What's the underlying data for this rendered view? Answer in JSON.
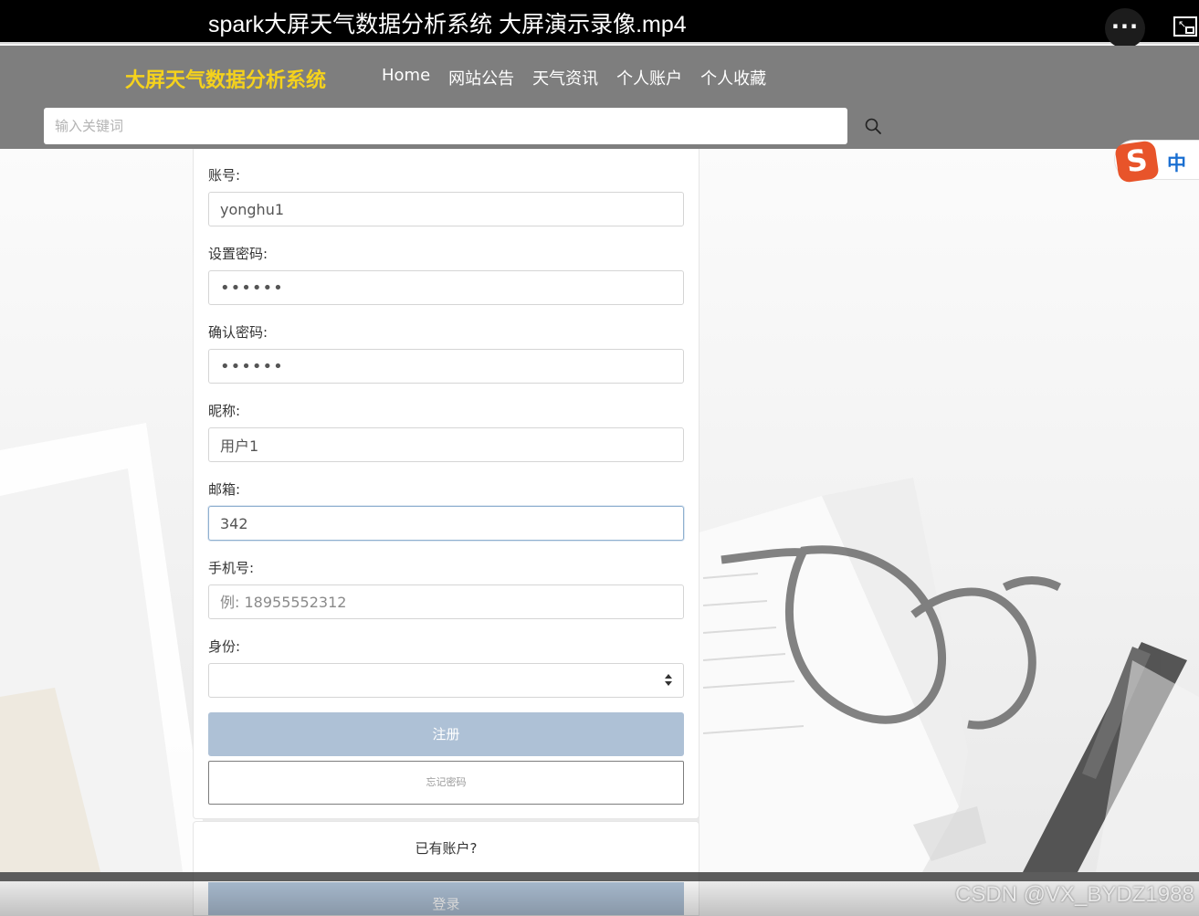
{
  "player": {
    "title": "spark大屏天气数据分析系统 大屏演示录像.mp4",
    "more_label": "···"
  },
  "header": {
    "brand": "大屏天气数据分析系统",
    "nav": [
      "Home",
      "网站公告",
      "天气资讯",
      "个人账户",
      "个人收藏"
    ],
    "search_placeholder": "输入关键词"
  },
  "ime": {
    "logo": "S",
    "lang": "中"
  },
  "form": {
    "account_label": "账号:",
    "account_value": "yonghu1",
    "password_label": "设置密码:",
    "password_value": "••••••",
    "confirm_label": "确认密码:",
    "confirm_value": "••••••",
    "nickname_label": "昵称:",
    "nickname_value": "用户1",
    "email_label": "邮箱:",
    "email_value": "342",
    "phone_label": "手机号:",
    "phone_placeholder": "例: 18955552312",
    "role_label": "身份:",
    "register_label": "注册",
    "forgot_label": "忘记密码"
  },
  "login": {
    "have_account": "已有账户?",
    "login_label": "登录"
  },
  "watermark": "CSDN @VX_BYDZ1988",
  "colors": {
    "brand": "#f5d21c",
    "header_bg": "#7e7e7e",
    "button_bg": "#aec1d6",
    "ime_logo": "#e8542a",
    "ime_lang": "#1a6fd1"
  }
}
